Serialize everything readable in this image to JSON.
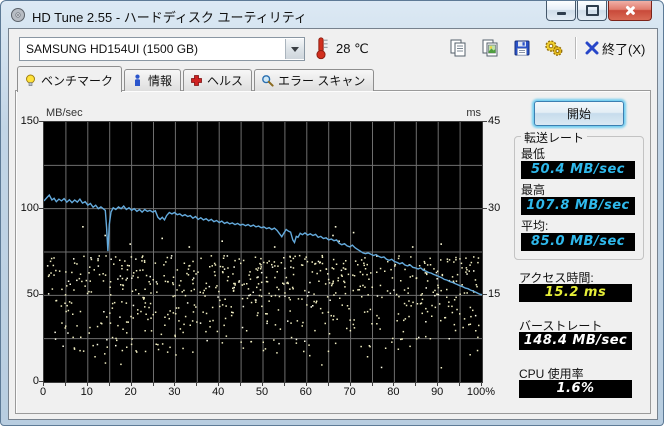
{
  "window": {
    "title": "HD Tune 2.55 - ハードディスク ユーティリティ"
  },
  "toolbar": {
    "drive_selected": "SAMSUNG HD154UI (1500 GB)",
    "temperature": "28 ℃",
    "exit_label": "終了(X)"
  },
  "tabs": [
    {
      "label": "ベンチマーク",
      "icon": "bulb-icon",
      "active": true
    },
    {
      "label": "情報",
      "icon": "info-icon",
      "active": false
    },
    {
      "label": "ヘルス",
      "icon": "health-cross-icon",
      "active": false
    },
    {
      "label": "エラー スキャン",
      "icon": "magnifier-icon",
      "active": false
    }
  ],
  "panel": {
    "start_button": "開始",
    "transfer_group": {
      "legend": "転送レート",
      "fields": [
        {
          "label": "最低",
          "value": "50.4 MB/sec",
          "color": "#2fb9ec"
        },
        {
          "label": "最高",
          "value": "107.8 MB/sec",
          "color": "#2fb9ec"
        },
        {
          "label": "平均:",
          "value": "85.0 MB/sec",
          "color": "#2fb9ec"
        }
      ]
    },
    "extra_fields": [
      {
        "label": "アクセス時間:",
        "value": "15.2 ms",
        "color": "#e6ee39"
      },
      {
        "label": "バーストレート",
        "value": "148.4 MB/sec",
        "color": "#ffffff"
      },
      {
        "label": "CPU 使用率",
        "value": "1.6%",
        "color": "#ffffff"
      }
    ]
  },
  "chart_data": {
    "type": "line+scatter",
    "title": "HD Tune benchmark - transfer rate and access time",
    "x_axis": {
      "range": [
        0,
        100
      ],
      "tick_step": 10,
      "minor_step": 5,
      "labels": [
        "0",
        "10",
        "20",
        "30",
        "40",
        "50",
        "60",
        "70",
        "80",
        "90",
        "100%"
      ]
    },
    "left_axis": {
      "label": "MB/sec",
      "range": [
        0,
        150
      ],
      "ticks": [
        150,
        100,
        50,
        0
      ],
      "series": "transfer_rate"
    },
    "right_axis": {
      "label": "ms",
      "range": [
        0,
        45
      ],
      "ticks": [
        45,
        30,
        15
      ],
      "series": "access_time"
    },
    "grid": {
      "x_step": 5,
      "y_step": 25,
      "color": "#6e6e6e",
      "background": "#000000"
    },
    "transfer_rate": {
      "name": "transfer rate",
      "unit": "MB/sec",
      "color": "#64aadc",
      "summary": {
        "min": 50.4,
        "max": 107.8,
        "avg": 85.0
      },
      "points": [
        [
          0,
          104.5
        ],
        [
          0.7,
          106.5
        ],
        [
          1.2,
          107.8
        ],
        [
          1.8,
          105
        ],
        [
          2.3,
          106
        ],
        [
          2.8,
          104
        ],
        [
          3.4,
          105.5
        ],
        [
          4,
          104.5
        ],
        [
          4.6,
          105.8
        ],
        [
          5.2,
          103.8
        ],
        [
          5.8,
          105.2
        ],
        [
          6.4,
          103.5
        ],
        [
          7,
          105
        ],
        [
          7.6,
          103.8
        ],
        [
          8.2,
          105.5
        ],
        [
          8.8,
          103.2
        ],
        [
          9.4,
          104
        ],
        [
          10,
          102
        ],
        [
          10.6,
          103
        ],
        [
          11.2,
          100.8
        ],
        [
          11.8,
          102
        ],
        [
          12.4,
          100
        ],
        [
          13,
          101
        ],
        [
          13.6,
          99.8
        ],
        [
          14,
          99
        ],
        [
          14.3,
          89
        ],
        [
          14.6,
          75.5
        ],
        [
          14.9,
          91
        ],
        [
          15.3,
          98
        ],
        [
          15.8,
          100.5
        ],
        [
          16.4,
          99.5
        ],
        [
          17,
          101
        ],
        [
          17.6,
          100
        ],
        [
          18.2,
          101.5
        ],
        [
          18.8,
          99.5
        ],
        [
          19.4,
          100.5
        ],
        [
          20,
          99
        ],
        [
          20.6,
          100
        ],
        [
          21.2,
          98.5
        ],
        [
          21.8,
          99.5
        ],
        [
          22.4,
          98
        ],
        [
          23,
          99.5
        ],
        [
          23.6,
          98.5
        ],
        [
          24.2,
          99
        ],
        [
          24.8,
          98
        ],
        [
          25.4,
          98.8
        ],
        [
          26,
          95
        ],
        [
          26.5,
          93.8
        ],
        [
          27,
          95
        ],
        [
          27.5,
          93.5
        ],
        [
          28,
          96
        ],
        [
          28.6,
          97.8
        ],
        [
          29.2,
          97
        ],
        [
          29.8,
          97.8
        ],
        [
          30.4,
          96.5
        ],
        [
          31,
          97
        ],
        [
          31.6,
          95.8
        ],
        [
          32.2,
          96.5
        ],
        [
          32.8,
          95.5
        ],
        [
          33.4,
          96
        ],
        [
          34,
          94.5
        ],
        [
          34.6,
          95.5
        ],
        [
          35.2,
          93.8
        ],
        [
          35.8,
          94.8
        ],
        [
          36.4,
          93.5
        ],
        [
          37,
          94.2
        ],
        [
          37.6,
          93
        ],
        [
          38.2,
          93.8
        ],
        [
          38.8,
          92.5
        ],
        [
          39.4,
          93.2
        ],
        [
          40,
          92
        ],
        [
          40.6,
          92.8
        ],
        [
          41.2,
          91.5
        ],
        [
          41.8,
          92.2
        ],
        [
          42.4,
          91.2
        ],
        [
          43,
          91.8
        ],
        [
          43.6,
          90.8
        ],
        [
          44.2,
          91.5
        ],
        [
          44.8,
          90.5
        ],
        [
          45.4,
          91
        ],
        [
          46,
          90.2
        ],
        [
          46.6,
          90.8
        ],
        [
          47.2,
          89.8
        ],
        [
          47.8,
          90.5
        ],
        [
          48.4,
          89.5
        ],
        [
          49,
          90
        ],
        [
          49.6,
          89
        ],
        [
          50.2,
          89.5
        ],
        [
          50.8,
          88.5
        ],
        [
          51.4,
          89
        ],
        [
          52,
          88
        ],
        [
          52.6,
          88.8
        ],
        [
          53.2,
          87.5
        ],
        [
          53.8,
          85.5
        ],
        [
          54.3,
          83.8
        ],
        [
          54.8,
          86
        ],
        [
          55.3,
          88
        ],
        [
          55.8,
          87
        ],
        [
          56.3,
          86.5
        ],
        [
          56.8,
          82
        ],
        [
          57.2,
          80.5
        ],
        [
          57.6,
          84
        ],
        [
          58,
          83.5
        ],
        [
          58.5,
          85.8
        ],
        [
          59,
          85
        ],
        [
          59.6,
          86
        ],
        [
          60.2,
          84.8
        ],
        [
          60.8,
          85.5
        ],
        [
          61.4,
          84.5
        ],
        [
          62,
          85.2
        ],
        [
          62.6,
          83.5
        ],
        [
          63.2,
          84
        ],
        [
          63.8,
          82.8
        ],
        [
          64.4,
          83.2
        ],
        [
          65,
          82
        ],
        [
          65.6,
          82.5
        ],
        [
          66.2,
          81.5
        ],
        [
          66.8,
          82
        ],
        [
          67.4,
          80
        ],
        [
          68,
          79.2
        ],
        [
          68.6,
          79.8
        ],
        [
          69.2,
          78.5
        ],
        [
          69.8,
          78
        ],
        [
          70.4,
          79
        ],
        [
          71,
          77.5
        ],
        [
          71.6,
          76.5
        ],
        [
          72.2,
          75.5
        ],
        [
          72.8,
          74.5
        ],
        [
          73.4,
          74
        ],
        [
          74,
          74.5
        ],
        [
          74.6,
          73.8
        ],
        [
          75.2,
          73
        ],
        [
          75.8,
          73.5
        ],
        [
          76.4,
          72.5
        ],
        [
          77,
          71.8
        ],
        [
          77.6,
          72.2
        ],
        [
          78.2,
          70.8
        ],
        [
          78.8,
          70.2
        ],
        [
          79.4,
          70.8
        ],
        [
          80,
          69.5
        ],
        [
          80.6,
          69
        ],
        [
          81.2,
          68.2
        ],
        [
          81.8,
          68.8
        ],
        [
          82.4,
          67.5
        ],
        [
          83,
          67
        ],
        [
          83.6,
          67.5
        ],
        [
          84.2,
          66.2
        ],
        [
          84.8,
          65.8
        ],
        [
          85.4,
          65.2
        ],
        [
          86,
          65.8
        ],
        [
          86.6,
          64.5
        ],
        [
          87.2,
          64
        ],
        [
          87.8,
          63.2
        ],
        [
          88.4,
          62.8
        ],
        [
          89,
          62
        ],
        [
          89.6,
          61.5
        ],
        [
          90.2,
          60.8
        ],
        [
          90.8,
          60.2
        ],
        [
          91.4,
          59.2
        ],
        [
          92,
          58.8
        ],
        [
          92.6,
          58
        ],
        [
          93.2,
          57.5
        ],
        [
          93.8,
          56.8
        ],
        [
          94.4,
          56.2
        ],
        [
          95,
          55.5
        ],
        [
          95.6,
          55
        ],
        [
          96.2,
          54.2
        ],
        [
          96.8,
          53.8
        ],
        [
          97.4,
          53
        ],
        [
          98,
          52.5
        ],
        [
          98.6,
          51.8
        ],
        [
          99.2,
          51
        ],
        [
          99.7,
          50.5
        ],
        [
          100,
          50.4
        ]
      ]
    },
    "access_time": {
      "name": "access time",
      "unit": "ms",
      "color": "#f2efc2",
      "style": "scatter",
      "summary": {
        "avg": 15.2
      },
      "seed": 42,
      "count": 720,
      "ms_min": 2.5,
      "ms_max": 22,
      "skew": 0.55,
      "outliers": [
        [
          8.7,
          27
        ],
        [
          13.8,
          25.5
        ],
        [
          19.5,
          24
        ],
        [
          26.8,
          25
        ],
        [
          33,
          23.5
        ],
        [
          40.5,
          24.5
        ],
        [
          52.5,
          23.5
        ],
        [
          65.8,
          25.5
        ],
        [
          66.4,
          27
        ],
        [
          67.2,
          24.5
        ],
        [
          70.5,
          26
        ],
        [
          84,
          23.5
        ],
        [
          90.5,
          24
        ]
      ]
    }
  }
}
